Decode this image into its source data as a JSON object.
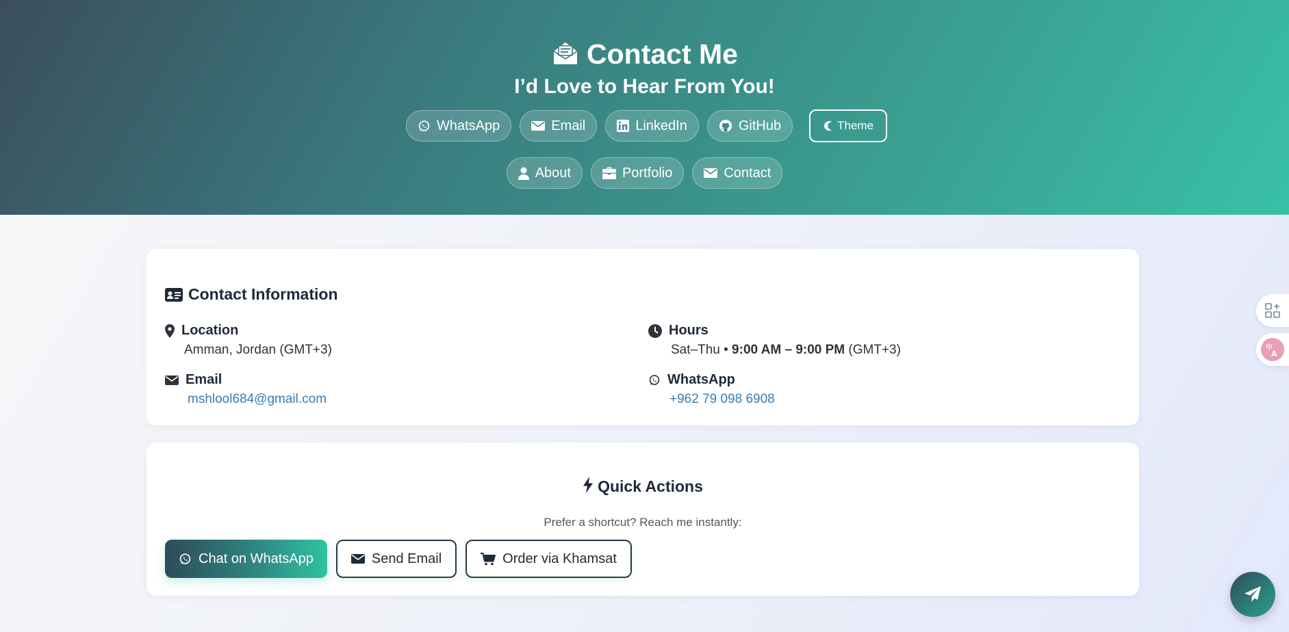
{
  "header": {
    "title": "Contact Me",
    "subtitle": "I’d Love to Hear From You!",
    "social_links": [
      {
        "label": "WhatsApp",
        "icon": "whatsapp-icon"
      },
      {
        "label": "Email",
        "icon": "envelope-icon"
      },
      {
        "label": "LinkedIn",
        "icon": "linkedin-icon"
      },
      {
        "label": "GitHub",
        "icon": "github-icon"
      }
    ],
    "theme_label": "Theme",
    "nav_links": [
      {
        "label": "About",
        "icon": "user-icon"
      },
      {
        "label": "Portfolio",
        "icon": "briefcase-icon"
      },
      {
        "label": "Contact",
        "icon": "envelope-icon"
      }
    ]
  },
  "contact_info": {
    "title": "Contact Information",
    "location": {
      "label": "Location",
      "value": "Amman, Jordan (GMT+3)"
    },
    "hours": {
      "label": "Hours",
      "days": "Sat–Thu • ",
      "time": "9:00 AM – 9:00 PM",
      "tz": " (GMT+3)"
    },
    "email": {
      "label": "Email",
      "value": "mshlool684@gmail.com"
    },
    "whatsapp": {
      "label": "WhatsApp",
      "value": "+962 79 098 6908"
    }
  },
  "quick_actions": {
    "title": "Quick Actions",
    "subtitle": "Prefer a shortcut? Reach me instantly:",
    "buttons": [
      {
        "label": "Chat on WhatsApp",
        "icon": "whatsapp-icon"
      },
      {
        "label": "Send Email",
        "icon": "envelope-icon"
      },
      {
        "label": "Order via Khamsat",
        "icon": "cart-icon"
      }
    ]
  },
  "colors": {
    "hero_start": "#3b4e5d",
    "hero_end": "#39c1a7",
    "link": "#3d7bb0",
    "dark_border": "#253745"
  }
}
